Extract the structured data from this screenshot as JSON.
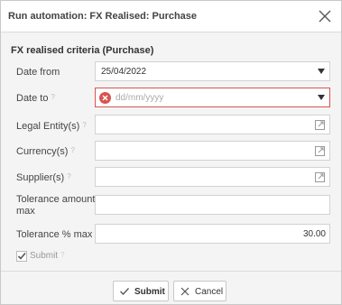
{
  "dialog": {
    "title": "Run automation: FX Realised: Purchase",
    "close_icon": "close-icon"
  },
  "section": {
    "title": "FX realised criteria (Purchase)"
  },
  "fields": {
    "date_from": {
      "label": "Date from",
      "value": "25/04/2022"
    },
    "date_to": {
      "label": "Date to",
      "placeholder": "dd/mm/yyyy",
      "error": true
    },
    "legal_entity": {
      "label": "Legal Entity(s)",
      "value": ""
    },
    "currency": {
      "label": "Currency(s)",
      "value": ""
    },
    "supplier": {
      "label": "Supplier(s)",
      "value": ""
    },
    "tolerance_amount": {
      "label": "Tolerance amount max",
      "value": ""
    },
    "tolerance_pct": {
      "label": "Tolerance % max",
      "value": "30.00"
    },
    "submit_checkbox": {
      "label": "Submit",
      "checked": true
    }
  },
  "help_mark": "?",
  "buttons": {
    "submit": "Submit",
    "cancel": "Cancel"
  },
  "colors": {
    "error": "#d9534f",
    "accent": "#6b8fae"
  }
}
